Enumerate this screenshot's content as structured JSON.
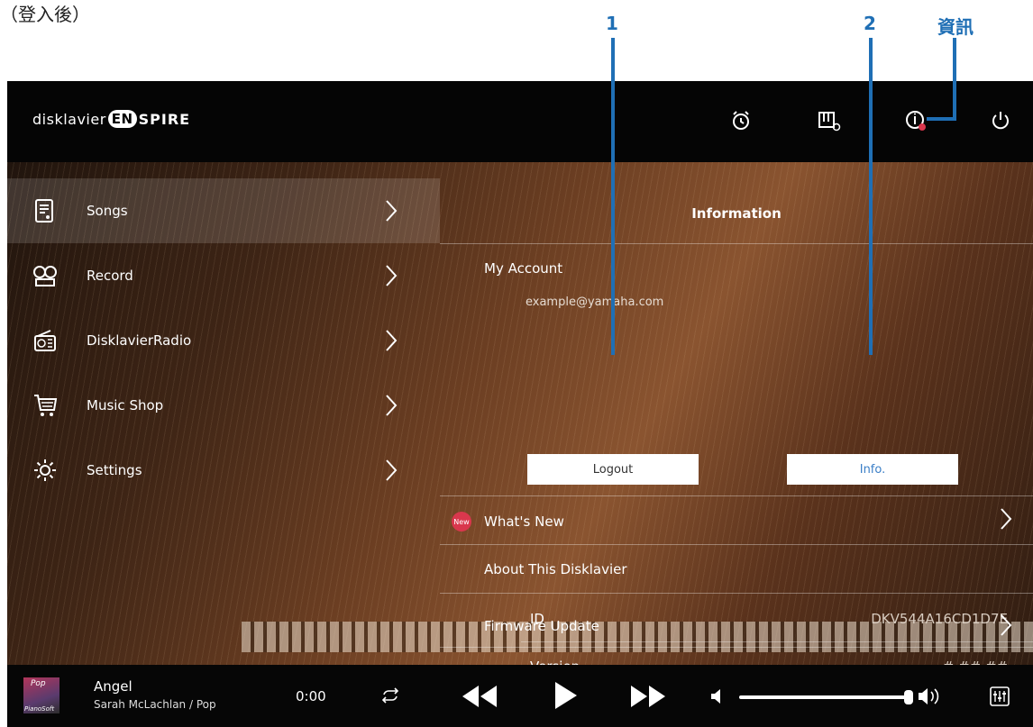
{
  "captions": {
    "login_state": "（登入後）",
    "callout_1": "1",
    "callout_2": "2",
    "callout_info": "資訊"
  },
  "header": {
    "logo_prefix": "disklavier",
    "logo_en": "EN",
    "logo_suffix": "SPIRE",
    "icons": [
      "alarm-icon",
      "piano-settings-icon",
      "info-icon",
      "power-icon"
    ]
  },
  "menu": {
    "items": [
      {
        "label": "Songs",
        "icon": "songs-icon",
        "active": true
      },
      {
        "label": "Record",
        "icon": "record-icon",
        "active": false
      },
      {
        "label": "DisklavierRadio",
        "icon": "radio-icon",
        "active": false
      },
      {
        "label": "Music Shop",
        "icon": "cart-icon",
        "active": false
      },
      {
        "label": "Settings",
        "icon": "gear-icon",
        "active": false
      }
    ]
  },
  "panel": {
    "title": "Information",
    "my_account": "My Account",
    "email": "example@yamaha.com",
    "logout_button": "Logout",
    "info_button": "Info.",
    "new_badge": "New",
    "whats_new": "What's New",
    "about": "About This Disklavier",
    "id_label": "ID",
    "id_value": "DKV544A16CD1D7E",
    "version_label": "Version",
    "version_value": "#.##.##",
    "firmware": "Firmware Update"
  },
  "player": {
    "album_genre": "Pop",
    "album_brand": "PianoSoft",
    "song_title": "Angel",
    "song_artist": "Sarah McLachlan / Pop",
    "time": "0:00",
    "volume_fraction": 0.96
  },
  "colors": {
    "accent": "#1f6fb5",
    "badge": "#d9374d",
    "info_link": "#3b7fc7"
  }
}
